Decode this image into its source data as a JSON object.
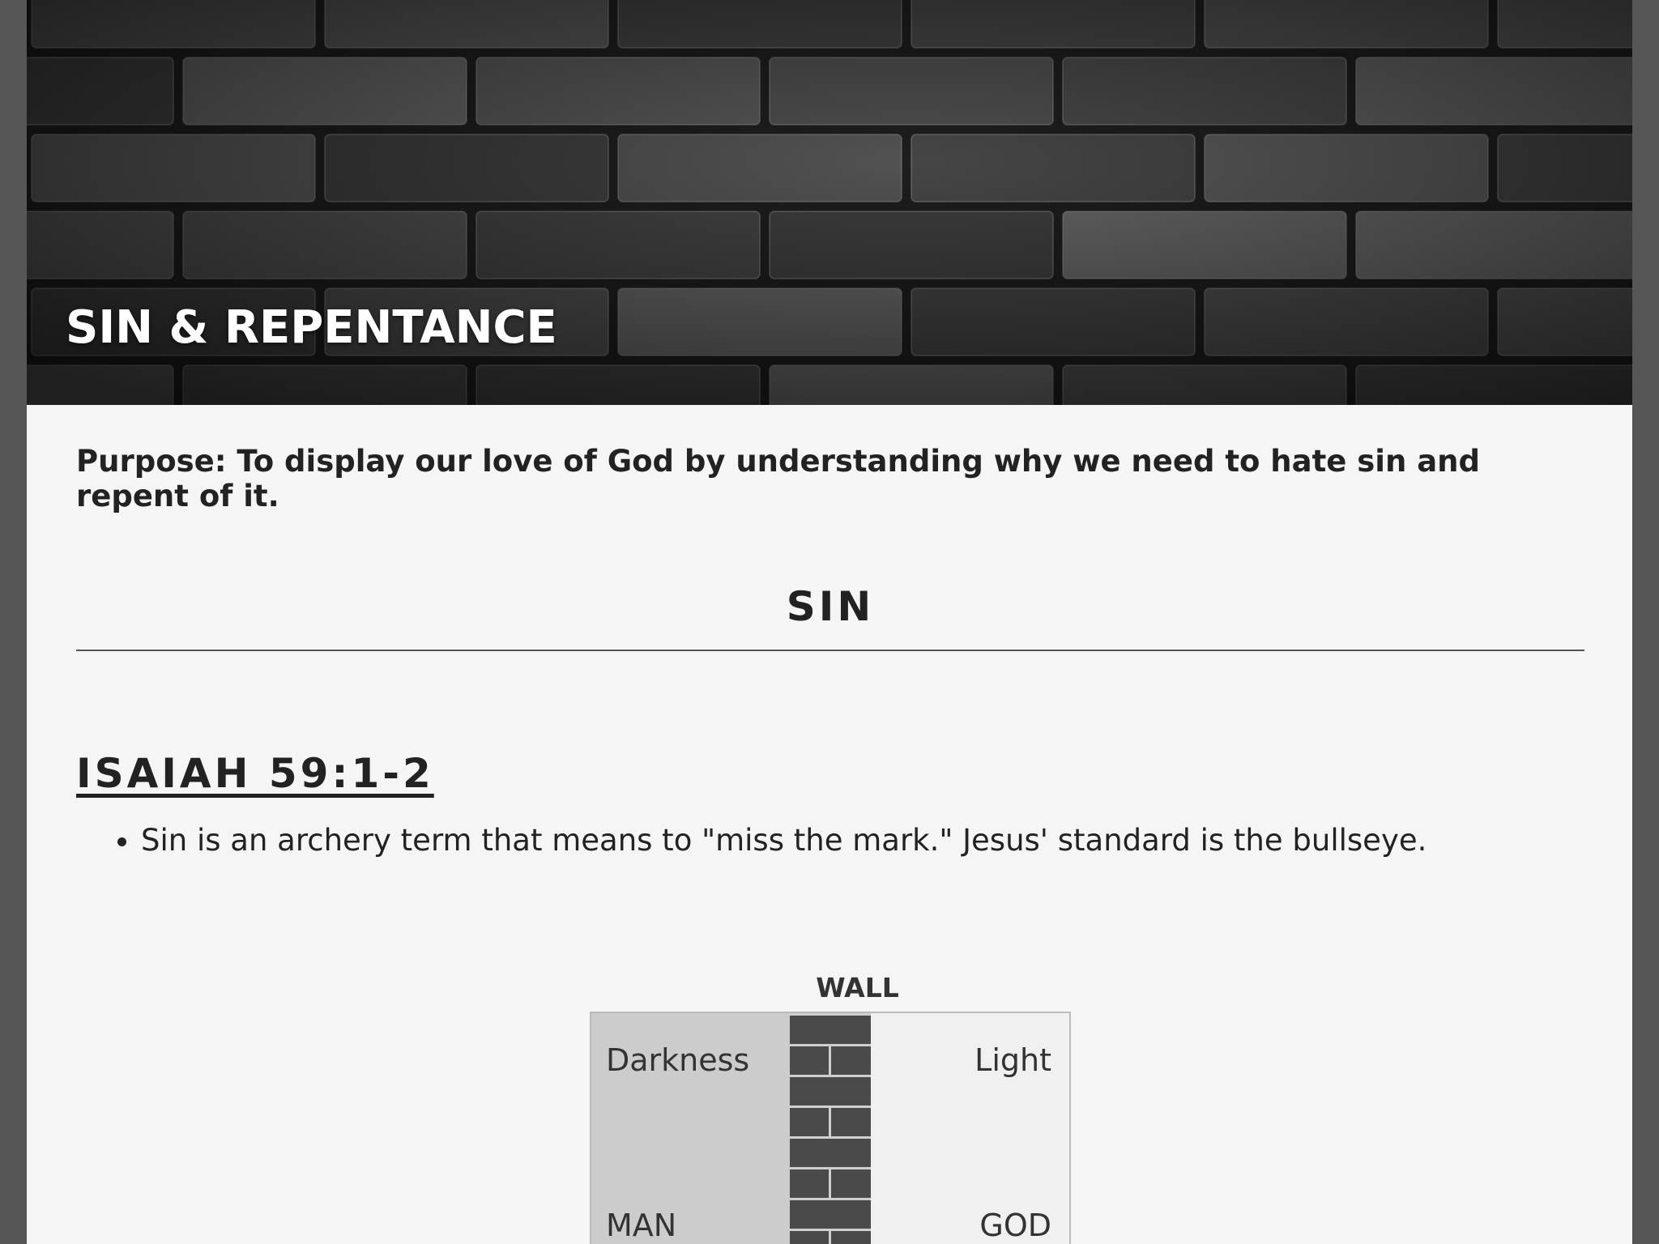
{
  "header": {
    "title": "SIN & REPENTANCE"
  },
  "main": {
    "purpose": "Purpose: To display our love of God by understanding why we need to hate sin and repent of it.",
    "section_heading": "SIN",
    "scripture_reference": "ISAIAH 59:1-2",
    "bullets": [
      "Sin is an archery term that means to \"miss the mark.\" Jesus' standard is the bullseye."
    ]
  },
  "diagram": {
    "wall_label": "WALL",
    "left_top": "Darkness",
    "right_top": "Light",
    "left_bottom": "MAN",
    "right_bottom": "GOD"
  },
  "colors": {
    "page_background": "#f5f5f5",
    "outer_background": "#555555",
    "hero_text": "#ffffff",
    "body_text": "#222222",
    "wall": "#4a4a4a",
    "darkness_side": "#cccccc",
    "light_side": "#f0f0f0"
  }
}
